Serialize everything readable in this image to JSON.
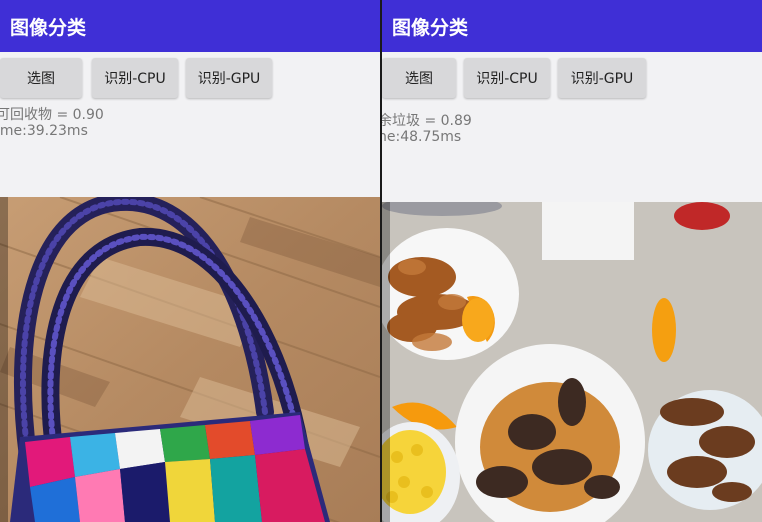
{
  "screens": [
    {
      "title": "图像分类",
      "buttons": {
        "pick": "选图",
        "cpu": "识别-CPU",
        "gpu": "识别-GPU"
      },
      "result_line": "可回收物 = 0.90",
      "time_line": "ime:39.23ms"
    },
    {
      "title": "图像分类",
      "buttons": {
        "pick": "选图",
        "cpu": "识别-CPU",
        "gpu": "识别-GPU"
      },
      "result_line": "余垃圾 = 0.89",
      "time_line": "ne:48.75ms"
    }
  ],
  "colors": {
    "appbar": "#3f2fd6",
    "button": "#d8d8da",
    "result_text": "#777777"
  },
  "icons": {
    "left_photo": "handbag-photo",
    "right_photo": "food-plates-photo"
  }
}
